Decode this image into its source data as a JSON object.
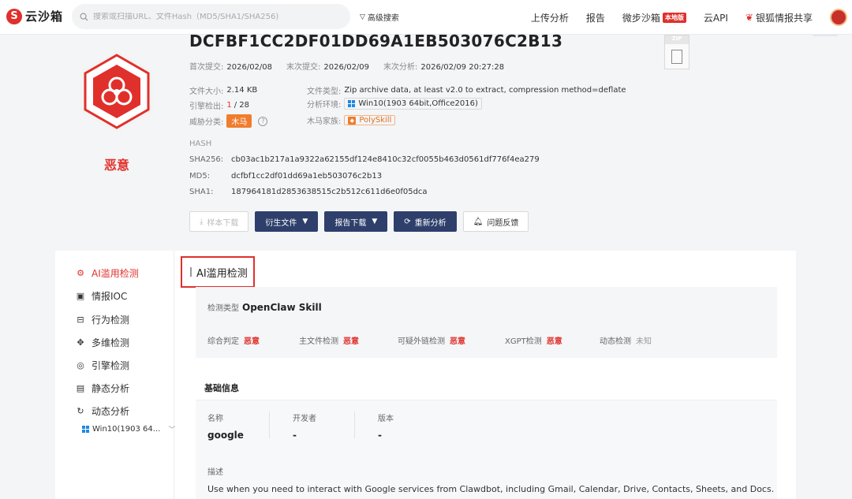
{
  "nav": {
    "logo_mark": "S",
    "logo_text": "云沙箱",
    "search_placeholder": "搜索或扫描URL、文件Hash（MD5/SHA1/SHA256)",
    "advanced_search": "高级搜索",
    "links": {
      "upload": "上传分析",
      "report": "报告",
      "weibu_sandbox": "微步沙箱",
      "local_badge": "本地版",
      "cloud_api": "云API",
      "intel_share": "银狐情报共享"
    }
  },
  "file": {
    "verdict": "恶意",
    "hash_title": "DCFBF1CC2DF01DD69A1EB503076C2B13",
    "file_type_badge": "ZIP",
    "first_submit_label": "首次提交:",
    "first_submit": "2026/02/08",
    "last_submit_label": "末次提交:",
    "last_submit": "2026/02/09",
    "last_analysis_label": "末次分析:",
    "last_analysis": "2026/02/09 20:27:28",
    "size_label": "文件大小:",
    "size": "2.14 KB",
    "engine_label": "引擎检出:",
    "engine_hits": "1",
    "engine_total": "/ 28",
    "threat_label": "威胁分类:",
    "threat": "木马",
    "type_label": "文件类型:",
    "type": "Zip archive data, at least v2.0 to extract, compression method=deflate",
    "env_label": "分析环境:",
    "env": "Win10(1903 64bit,Office2016)",
    "family_label": "木马家族:",
    "family": "PolySkill"
  },
  "hash": {
    "heading": "HASH",
    "sha256_label": "SHA256:",
    "sha256": "cb03ac1b217a1a9322a62155df124e8410c32cf0055b463d0561df776f4ea279",
    "md5_label": "MD5:",
    "md5": "dcfbf1cc2df01dd69a1eb503076c2b13",
    "sha1_label": "SHA1:",
    "sha1": "187964181d2853638515c2b512c611d6e0f05dca"
  },
  "actions": {
    "sample_download": "样本下载",
    "derived_files": "衍生文件",
    "report_download": "报告下载",
    "reanalyze": "重新分析",
    "feedback": "问题反馈"
  },
  "sidebar": {
    "items": [
      {
        "label": "AI滥用检测",
        "icon": "ai-icon"
      },
      {
        "label": "情报IOC",
        "icon": "intel-icon"
      },
      {
        "label": "行为检测",
        "icon": "behavior-icon"
      },
      {
        "label": "多维检测",
        "icon": "multi-icon"
      },
      {
        "label": "引擎检测",
        "icon": "engine-icon"
      },
      {
        "label": "静态分析",
        "icon": "static-icon"
      },
      {
        "label": "动态分析",
        "icon": "dynamic-icon"
      }
    ],
    "env_short": "Win10(1903 64..."
  },
  "ai_section": {
    "title": "AI滥用检测",
    "type_label": "检测类型",
    "type_value": "OpenClaw Skill",
    "results": [
      {
        "label": "综合判定",
        "value": "恶意"
      },
      {
        "label": "主文件检测",
        "value": "恶意"
      },
      {
        "label": "可疑外链检测",
        "value": "恶意"
      },
      {
        "label": "XGPT检测",
        "value": "恶意"
      },
      {
        "label": "动态检测",
        "value": "未知"
      }
    ]
  },
  "basic_info": {
    "tab": "基础信息",
    "name_label": "名称",
    "name": "google",
    "developer_label": "开发者",
    "developer": "-",
    "version_label": "版本",
    "version": "-",
    "desc_label": "描述",
    "desc": "Use when you need to interact with Google services from Clawdbot, including Gmail, Calendar, Drive, Contacts, Sheets, and Docs."
  },
  "colors": {
    "brand_red": "#e0302b",
    "primary_navy": "#2e3f6b",
    "trojan_orange": "#f07d2e"
  }
}
